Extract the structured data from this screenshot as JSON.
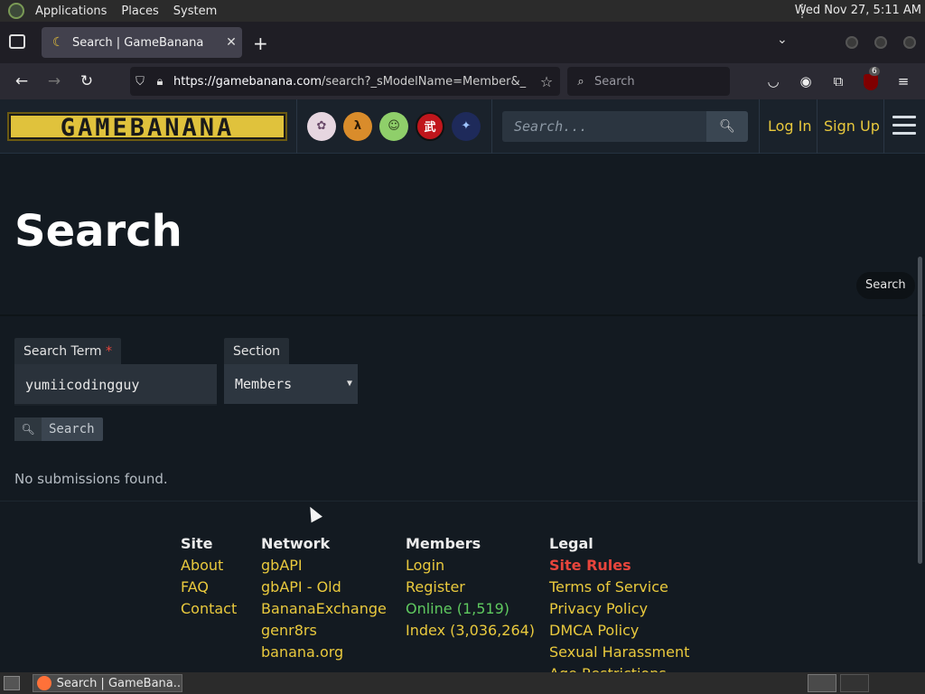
{
  "system_panel": {
    "menus": [
      "Applications",
      "Places",
      "System"
    ],
    "clock": "Wed Nov 27,  5:11 AM"
  },
  "browser": {
    "tab_title": "Search | GameBanana",
    "url_host": "https://gamebanana.com",
    "url_path": "/search?_sModelName=Member&_",
    "search_placeholder": "Search",
    "extension_badge": "6"
  },
  "site": {
    "logo_text": "GAMEBANANA",
    "header_search_placeholder": "Search...",
    "login_label": "Log In",
    "signup_label": "Sign Up",
    "game_icons": [
      "character-avatar-icon",
      "half-life-2-icon",
      "baldi-icon",
      "wu-icon",
      "anime-game-icon"
    ]
  },
  "page": {
    "title": "Search",
    "breadcrumb": "Search",
    "form": {
      "search_term_label": "Search Term",
      "required_marker": "*",
      "search_term_value": "yumiicodingguy",
      "section_label": "Section",
      "section_value": "Members",
      "submit_label": "Search"
    },
    "no_results": "No submissions found."
  },
  "footer": {
    "site": {
      "title": "Site",
      "links": [
        "About",
        "FAQ",
        "Contact"
      ]
    },
    "network": {
      "title": "Network",
      "links": [
        "gbAPI",
        "gbAPI - Old",
        "BananaExchange",
        "genr8rs",
        "banana.org"
      ]
    },
    "members": {
      "title": "Members",
      "links": [
        "Login",
        "Register",
        "Online (1,519)",
        "Index (3,036,264)"
      ]
    },
    "legal": {
      "title": "Legal",
      "links": [
        "Site Rules",
        "Terms of Service",
        "Privacy Policy",
        "DMCA Policy",
        "Sexual Harassment",
        "Age Restrictions"
      ]
    }
  },
  "taskbar": {
    "task_label": "Search | GameBana..."
  }
}
